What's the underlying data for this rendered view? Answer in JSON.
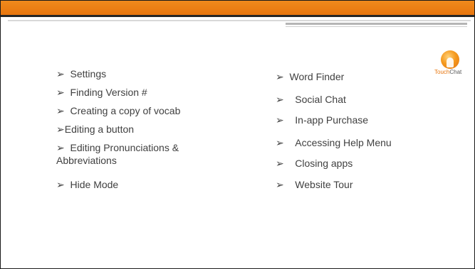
{
  "slide": {
    "left_items": [
      {
        "bullet": "➢",
        "text": "Settings"
      },
      {
        "bullet": "➢",
        "text": "Finding Version #"
      },
      {
        "bullet": "➢",
        "text": "Creating a copy of vocab"
      },
      {
        "bullet": "➢",
        "text": "Editing a button"
      },
      {
        "bullet": "➢",
        "text": "Editing Pronunciations &",
        "continuation": "Abbreviations"
      },
      {
        "bullet": "➢",
        "text": "Hide Mode"
      }
    ],
    "right_items": [
      {
        "bullet": "➢",
        "text": "Word Finder"
      },
      {
        "bullet": "➢",
        "text": "Social Chat"
      },
      {
        "bullet": "➢",
        "text": "In-app Purchase"
      },
      {
        "bullet": "➢",
        "text": "Accessing Help Menu"
      },
      {
        "bullet": "➢",
        "text": "Closing apps"
      },
      {
        "bullet": "➢",
        "text": "Website Tour"
      }
    ]
  },
  "logo": {
    "word1": "Touch",
    "word2": "Chat",
    "icon": "touchchat-logo-icon"
  },
  "colors": {
    "accent": "#e8760e",
    "text": "#404040",
    "dark_band": "#262626"
  }
}
